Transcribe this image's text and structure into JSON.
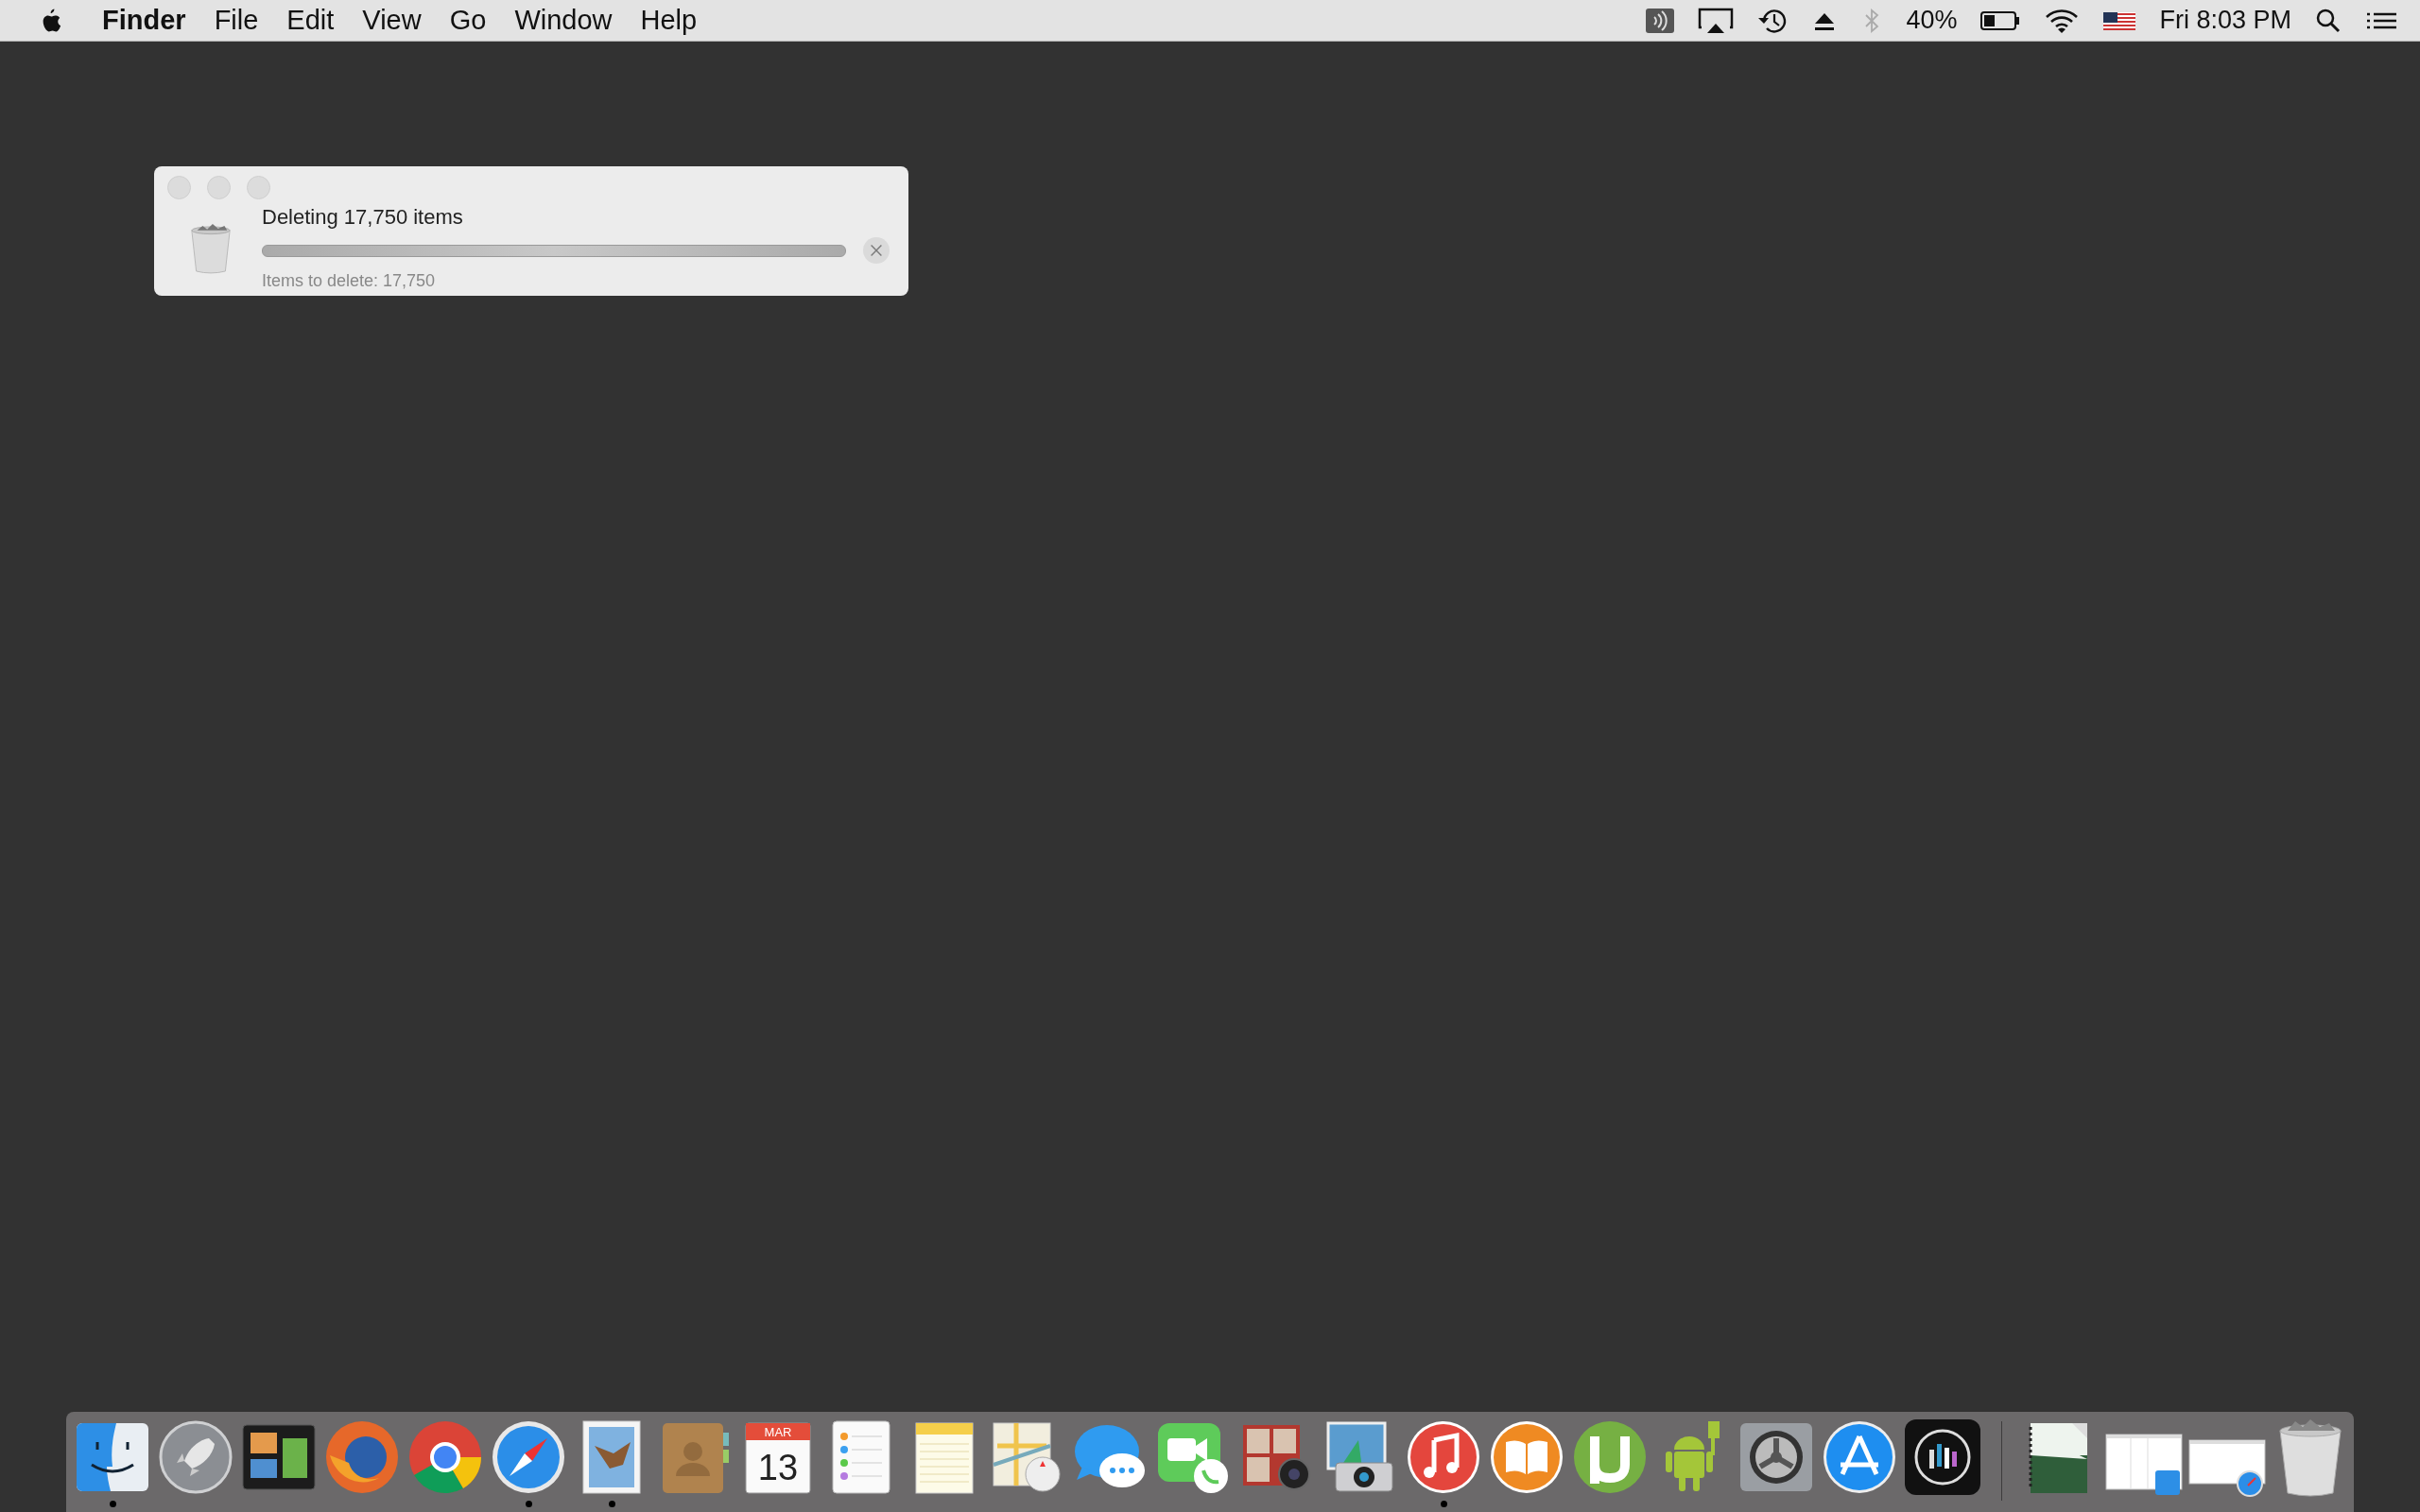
{
  "menu_bar": {
    "app_name": "Finder",
    "menus": [
      "File",
      "Edit",
      "View",
      "Go",
      "Window",
      "Help"
    ],
    "battery_percent": "40%",
    "clock": "Fri 8:03 PM"
  },
  "progress_window": {
    "title": "Deleting 17,750 items",
    "detail": "Items to delete: 17,750",
    "level": 0
  },
  "dock": {
    "apps": [
      {
        "kind": "finder",
        "running": true
      },
      {
        "kind": "launchpad",
        "running": false
      },
      {
        "kind": "mission",
        "running": false
      },
      {
        "kind": "firefox",
        "running": false
      },
      {
        "kind": "chrome",
        "running": false
      },
      {
        "kind": "safari",
        "running": true
      },
      {
        "kind": "mail",
        "running": true
      },
      {
        "kind": "contacts",
        "running": false
      },
      {
        "kind": "calendar",
        "running": false,
        "month": "MAR",
        "day": "13"
      },
      {
        "kind": "reminders",
        "running": false
      },
      {
        "kind": "notes",
        "running": false
      },
      {
        "kind": "maps",
        "running": false
      },
      {
        "kind": "messages",
        "running": false
      },
      {
        "kind": "facetime",
        "running": false
      },
      {
        "kind": "photobooth",
        "running": false
      },
      {
        "kind": "imagecapture",
        "running": false
      },
      {
        "kind": "itunes",
        "running": true
      },
      {
        "kind": "ibooks",
        "running": false
      },
      {
        "kind": "utorrent",
        "running": false
      },
      {
        "kind": "android",
        "running": false
      },
      {
        "kind": "sysprefs",
        "running": false
      },
      {
        "kind": "appstore",
        "running": false
      },
      {
        "kind": "equalizer",
        "running": false
      }
    ],
    "others": [
      {
        "kind": "document"
      },
      {
        "kind": "finderwindow"
      },
      {
        "kind": "safariwindow"
      },
      {
        "kind": "trash"
      }
    ]
  }
}
